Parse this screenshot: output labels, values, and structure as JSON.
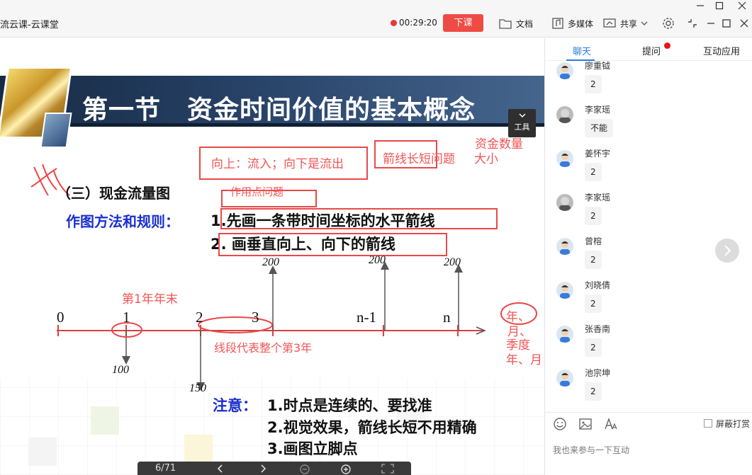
{
  "titlebar": {
    "title": "流云课-云课堂",
    "timer": "00:29:20",
    "end_class": "下课",
    "docs": "文档",
    "media": "多媒体",
    "share": "共享"
  },
  "slide": {
    "title": "第一节　资金时间价值的基本概念",
    "tools": "工具",
    "section_title": "（三）现金流量图",
    "rules_label": "作图方法和规则：",
    "rule1": "1.先画一条带时间坐标的水平箭线",
    "rule2": "2. 画垂直向上、向下的箭线",
    "handwritten": {
      "up_down": "向上：流入；向下是流出",
      "arrow_len": "箭线长短问题",
      "size": "大小",
      "amount": "资金数量",
      "action_point": "作用点问题",
      "year1_end": "第1年年末",
      "segment": "线段代表整个第3年",
      "units": [
        "年、",
        "月、",
        "季度",
        "年、月"
      ]
    },
    "axis_labels": [
      "0",
      "1",
      "2",
      "3",
      "n-1",
      "n"
    ],
    "values_up": [
      "200",
      "200",
      "200"
    ],
    "values_down": [
      "100",
      "150"
    ],
    "note_label": "注意：",
    "notes": [
      "1.时点是连续的、要找准",
      "2.视觉效果，箭线长短不用精确",
      "3.画图立脚点"
    ],
    "pager": "6/71"
  },
  "panel": {
    "tabs": [
      "聊天",
      "提问",
      "互动应用"
    ],
    "messages": [
      {
        "name": "廖重钺",
        "text": "2"
      },
      {
        "name": "李家瑶",
        "text": "不能"
      },
      {
        "name": "姜怀宇",
        "text": "2"
      },
      {
        "name": "李家瑶",
        "text": "2"
      },
      {
        "name": "曾榕",
        "text": "2"
      },
      {
        "name": "刘晓倩",
        "text": "2"
      },
      {
        "name": "张香南",
        "text": "2"
      },
      {
        "name": "池宗坤",
        "text": "2"
      }
    ],
    "block_tips": "屏蔽打赏",
    "input_placeholder": "我也来参与一下互动"
  },
  "colors": {
    "accent": "#2b7be0",
    "end_button": "#ef4b45",
    "annotation": "#ea4848",
    "rule_blue": "#1a2fd0"
  }
}
